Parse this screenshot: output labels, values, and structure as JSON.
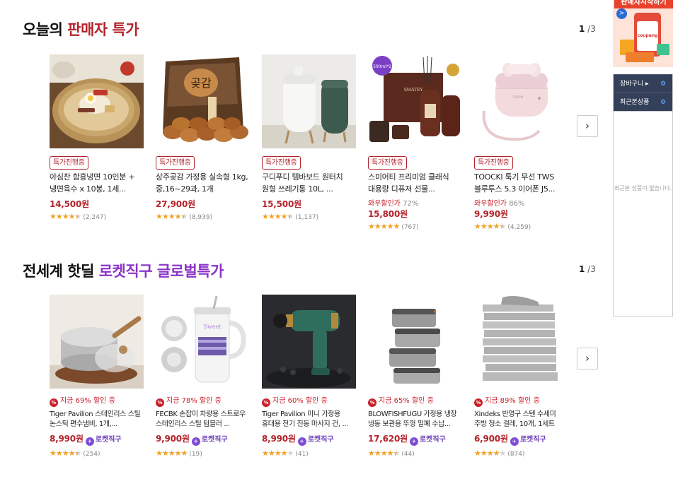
{
  "section1": {
    "title_prefix": "오늘의 ",
    "title_highlight": "판매자 특가",
    "page_current": "1",
    "page_total": " /3",
    "next_label": "›",
    "products": [
      {
        "tag": "특가진행중",
        "name": "야심찬 함흥냉면 10인분 + 냉면육수 x 10봉, 1세...",
        "price": "14,500원",
        "reviews": "(2,247)",
        "rating": 4.5
      },
      {
        "tag": "특가진행중",
        "name": "상주곶감 가정용 실속형 1kg, 중,16~29과, 1개",
        "price": "27,900원",
        "reviews": "(8,939)",
        "rating": 4.5
      },
      {
        "tag": "특가진행중",
        "name": "구디푸디 템바보드 원터치 원형 쓰레기통 10L, ...",
        "price": "15,500원",
        "reviews": "(1,137)",
        "rating": 4.5
      },
      {
        "tag": "특가진행중",
        "name": "스미어티 프리미엄 클래식 대용량 디퓨저 선물...",
        "wow": "와우할인가",
        "wow_pct": "72%",
        "price": "15,800원",
        "reviews": "(767)",
        "rating": 5
      },
      {
        "tag": "특가진행중",
        "name": "TOOCKI 툭기 무선 TWS 블루투스 5.3 이어폰 J5...",
        "wow": "와우할인가",
        "wow_pct": "86%",
        "price": "9,990원",
        "reviews": "(4,259)",
        "rating": 4.5
      }
    ]
  },
  "section2": {
    "title_prefix": "전세계 핫딜 ",
    "title_highlight": "로켓직구 글로벌특가",
    "page_current": "1",
    "page_total": " /3",
    "next_label": "›",
    "rocket_label": "로켓직구",
    "products": [
      {
        "discount": "지금 69% 할인 중",
        "name": "Tiger Pavilion 스테인리스 스틸 논스틱 편수냄비, 1개,...",
        "price": "8,990원",
        "reviews": "(254)",
        "rating": 4.5
      },
      {
        "discount": "지금 78% 할인 중",
        "name": "FECBK 손잡이 차량용 스트로우 스테인리스 스틸 텀블러 ...",
        "price": "9,900원",
        "reviews": "(19)",
        "rating": 5
      },
      {
        "discount": "지금 60% 할인 중",
        "name": "Tiger Pavilion 미니 가정용 휴대용 전기 진동 마사지 건, ...",
        "price": "8,990원",
        "reviews": "(41)",
        "rating": 4
      },
      {
        "discount": "지금 65% 할인 중",
        "name": "BLOWFISHFUGU 가정용 냉장 냉동 보관용 뚜껑 밀폐 수납...",
        "price": "17,620원",
        "reviews": "(44)",
        "rating": 4.5
      },
      {
        "discount": "지금 89% 할인 중",
        "name": "Xindeks 반영구 스텐 수세미 주방 청소 걸레, 10개, 1세트",
        "price": "6,900원",
        "reviews": "(874)",
        "rating": 4
      }
    ]
  },
  "sidebar": {
    "banner_title": "판매자시작하기",
    "banner_arrow": ">",
    "banner_logo": "coupang",
    "cart_label": "장바구니 ▸",
    "cart_count": "0",
    "recent_label": "최근본상품",
    "recent_count": "0",
    "empty_text": "최근본 상품이 없습니다."
  },
  "colors": {
    "accent_red": "#b4232b",
    "rocket_purple": "#8a34c9",
    "star": "#f0a227",
    "side_dark": "#34405a"
  }
}
